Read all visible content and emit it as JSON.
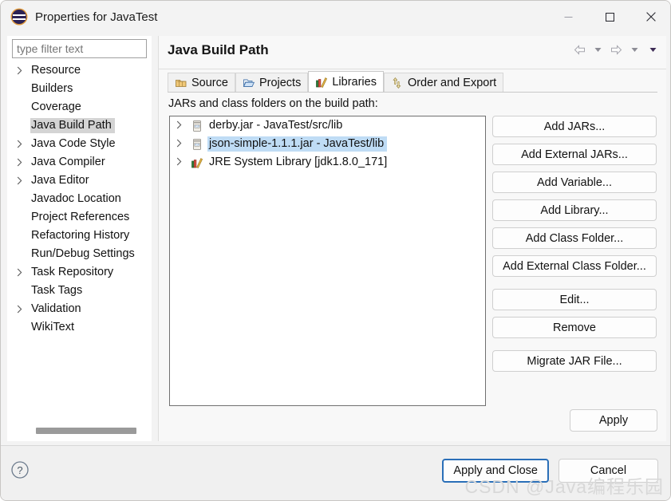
{
  "window": {
    "title": "Properties for JavaTest",
    "icon": "eclipse-icon",
    "controls": {
      "minimize": "minimize-icon",
      "maximize": "maximize-icon",
      "close": "close-icon"
    }
  },
  "sidebar": {
    "filter_placeholder": "type filter text",
    "filter_value": "",
    "items": [
      {
        "label": "Resource",
        "expandable": true,
        "selected": false
      },
      {
        "label": "Builders",
        "expandable": false,
        "selected": false
      },
      {
        "label": "Coverage",
        "expandable": false,
        "selected": false
      },
      {
        "label": "Java Build Path",
        "expandable": false,
        "selected": true
      },
      {
        "label": "Java Code Style",
        "expandable": true,
        "selected": false
      },
      {
        "label": "Java Compiler",
        "expandable": true,
        "selected": false
      },
      {
        "label": "Java Editor",
        "expandable": true,
        "selected": false
      },
      {
        "label": "Javadoc Location",
        "expandable": false,
        "selected": false
      },
      {
        "label": "Project References",
        "expandable": false,
        "selected": false
      },
      {
        "label": "Refactoring History",
        "expandable": false,
        "selected": false
      },
      {
        "label": "Run/Debug Settings",
        "expandable": false,
        "selected": false
      },
      {
        "label": "Task Repository",
        "expandable": true,
        "selected": false
      },
      {
        "label": "Task Tags",
        "expandable": false,
        "selected": false
      },
      {
        "label": "Validation",
        "expandable": true,
        "selected": false
      },
      {
        "label": "WikiText",
        "expandable": false,
        "selected": false
      }
    ]
  },
  "page": {
    "title": "Java Build Path",
    "nav": {
      "back": "back-arrow-icon",
      "back_menu": "chevron-down-icon",
      "forward": "forward-arrow-icon",
      "forward_menu": "chevron-down-icon",
      "view_menu": "chevron-down-icon"
    },
    "tabs": [
      {
        "label": "Source",
        "icon": "source-folder-icon",
        "active": false
      },
      {
        "label": "Projects",
        "icon": "open-folder-icon",
        "active": false
      },
      {
        "label": "Libraries",
        "icon": "library-books-icon",
        "active": true
      },
      {
        "label": "Order and Export",
        "icon": "order-arrows-icon",
        "active": false
      }
    ],
    "list_caption": "JARs and class folders on the build path:",
    "entries": [
      {
        "label": "derby.jar - JavaTest/src/lib",
        "icon": "jar-icon",
        "selected": false
      },
      {
        "label": "json-simple-1.1.1.jar - JavaTest/lib",
        "icon": "jar-icon",
        "selected": true
      },
      {
        "label": "JRE System Library [jdk1.8.0_171]",
        "icon": "library-books-icon",
        "selected": false
      }
    ],
    "side_buttons": [
      {
        "label": "Add JARs...",
        "gap_before": false
      },
      {
        "label": "Add External JARs...",
        "gap_before": false
      },
      {
        "label": "Add Variable...",
        "gap_before": false
      },
      {
        "label": "Add Library...",
        "gap_before": false
      },
      {
        "label": "Add Class Folder...",
        "gap_before": false
      },
      {
        "label": "Add External Class Folder...",
        "gap_before": false
      },
      {
        "label": "Edit...",
        "gap_before": true
      },
      {
        "label": "Remove",
        "gap_before": false
      },
      {
        "label": "Migrate JAR File...",
        "gap_before": true
      }
    ],
    "apply_label": "Apply"
  },
  "footer": {
    "help_icon": "help-circle-icon",
    "apply_and_close_label": "Apply and Close",
    "cancel_label": "Cancel"
  },
  "watermark": "CSDN @Java编程乐园",
  "colors": {
    "selection_blue": "#bfdcf5",
    "nav_selection_gray": "#d4d4d4",
    "focus_border": "#2a6fb8",
    "dialog_bg": "#f3f3f3"
  }
}
